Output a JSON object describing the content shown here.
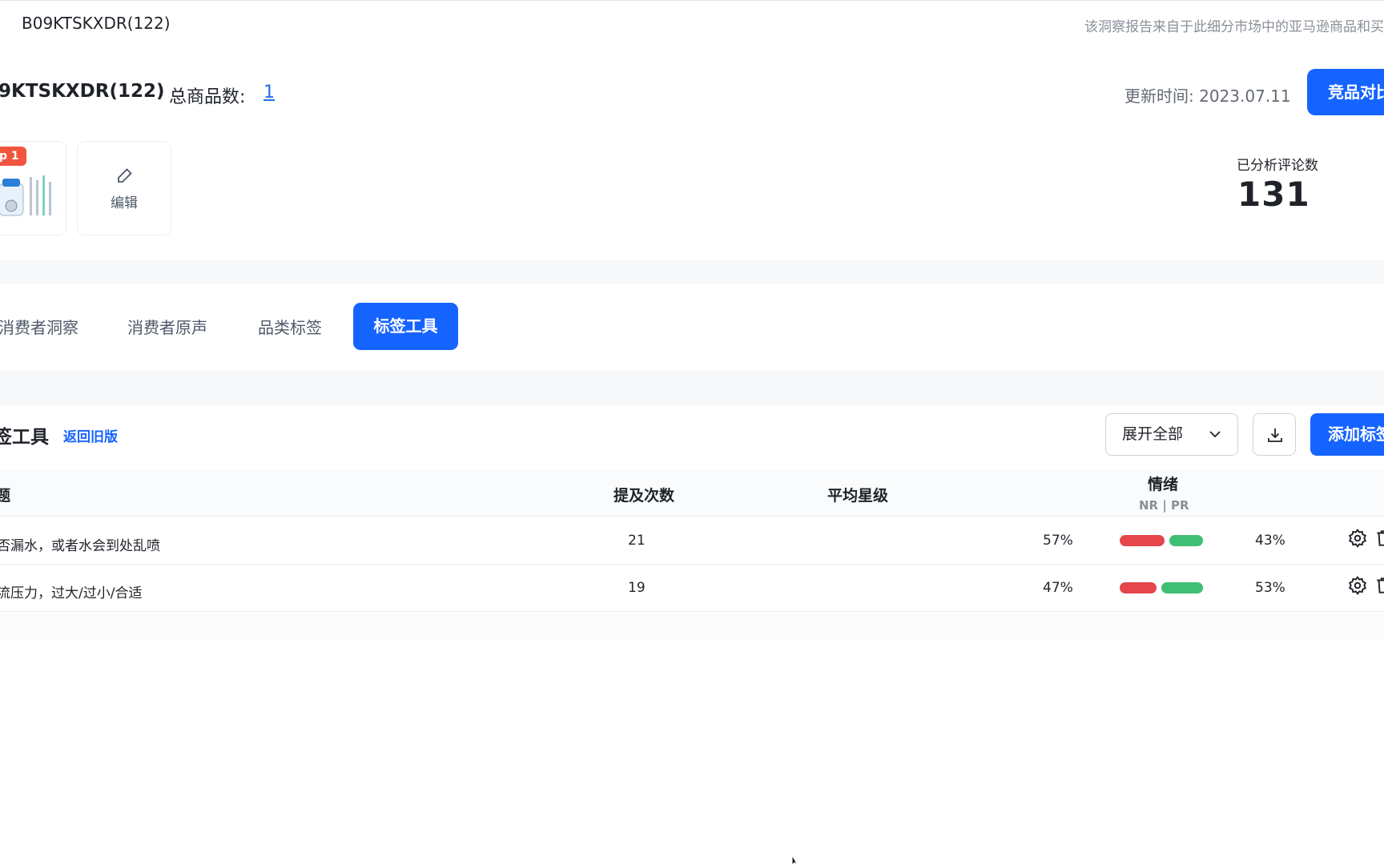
{
  "breadcrumb": {
    "text": "B09KTSKXDR(122)"
  },
  "notice": "该洞察报告来自于此细分市场中的亚马逊商品和买",
  "header": {
    "title": "9KTSKXDR(122)",
    "total_label": "总商品数:",
    "total_count": "1",
    "update_time": "更新时间: 2023.07.11",
    "compare_button": "竞品对比"
  },
  "product": {
    "badge": "p 1",
    "edit_label": "编辑"
  },
  "stats": {
    "review_label": "已分析评论数",
    "review_count": "131"
  },
  "tabs": [
    {
      "label": "消费者洞察",
      "active": false
    },
    {
      "label": "消费者原声",
      "active": false
    },
    {
      "label": "品类标签",
      "active": false
    },
    {
      "label": "标签工具",
      "active": true
    }
  ],
  "tag_tool": {
    "title": "签工具",
    "back_link": "返回旧版",
    "expand_button": "展开全部",
    "add_button": "添加标签"
  },
  "table": {
    "columns": {
      "topic": "题",
      "mentions": "提及次数",
      "avg_rating": "平均星级",
      "sentiment": "情绪",
      "sentiment_sub": "NR | PR"
    },
    "rows": [
      {
        "topic": "否漏水，或者水会到处乱喷",
        "mentions": "21",
        "nr": "57%",
        "pr": "43%",
        "nr_value": 57,
        "pr_value": 43
      },
      {
        "topic": "流压力，过大/过小/合适",
        "mentions": "19",
        "nr": "47%",
        "pr": "53%",
        "nr_value": 47,
        "pr_value": 53
      }
    ]
  },
  "colors": {
    "accent": "#1664ff",
    "negative": "#e5454b",
    "positive": "#3fbf73"
  }
}
